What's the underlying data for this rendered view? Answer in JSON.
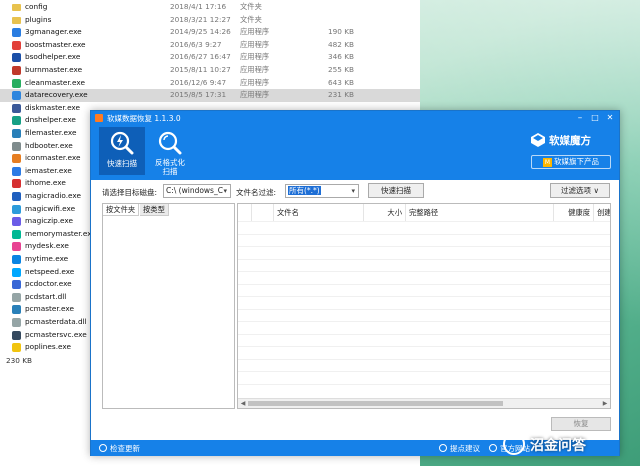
{
  "explorer": {
    "files": [
      {
        "name": "config",
        "date": "2018/4/1 17:16",
        "type": "文件夹",
        "size": "",
        "icon": "folder-icon",
        "color": "#e8c24e"
      },
      {
        "name": "plugins",
        "date": "2018/3/21 12:27",
        "type": "文件夹",
        "size": "",
        "icon": "folder-icon",
        "color": "#e8c24e"
      },
      {
        "name": "3gmanager.exe",
        "date": "2014/9/25 14:26",
        "type": "应用程序",
        "size": "190 KB",
        "icon": "app-icon",
        "color": "#2a7de1"
      },
      {
        "name": "boostmaster.exe",
        "date": "2016/6/3 9:27",
        "type": "应用程序",
        "size": "482 KB",
        "icon": "app-icon",
        "color": "#e2403a"
      },
      {
        "name": "bsodhelper.exe",
        "date": "2016/6/27 16:47",
        "type": "应用程序",
        "size": "346 KB",
        "icon": "app-icon",
        "color": "#1b4fa8"
      },
      {
        "name": "burnmaster.exe",
        "date": "2015/8/11 10:27",
        "type": "应用程序",
        "size": "255 KB",
        "icon": "app-icon",
        "color": "#c0392b"
      },
      {
        "name": "cleanmaster.exe",
        "date": "2016/12/6 9:47",
        "type": "应用程序",
        "size": "643 KB",
        "icon": "app-icon",
        "color": "#27ae60"
      },
      {
        "name": "datarecovery.exe",
        "date": "2015/8/5 17:31",
        "type": "应用程序",
        "size": "231 KB",
        "icon": "app-icon",
        "color": "#2e86de",
        "selected": true
      },
      {
        "name": "diskmaster.exe",
        "date": "",
        "type": "",
        "size": "",
        "icon": "app-icon",
        "color": "#3b5998"
      },
      {
        "name": "dnshelper.exe",
        "date": "",
        "type": "",
        "size": "",
        "icon": "app-icon",
        "color": "#16a085"
      },
      {
        "name": "filemaster.exe",
        "date": "",
        "type": "",
        "size": "",
        "icon": "app-icon",
        "color": "#2980b9"
      },
      {
        "name": "hdbooter.exe",
        "date": "",
        "type": "",
        "size": "",
        "icon": "app-icon",
        "color": "#7f8c8d"
      },
      {
        "name": "iconmaster.exe",
        "date": "",
        "type": "",
        "size": "",
        "icon": "app-icon",
        "color": "#e67e22"
      },
      {
        "name": "iemaster.exe",
        "date": "",
        "type": "",
        "size": "",
        "icon": "app-icon",
        "color": "#2c7be5"
      },
      {
        "name": "ithome.exe",
        "date": "",
        "type": "",
        "size": "",
        "icon": "app-icon",
        "color": "#d63031"
      },
      {
        "name": "magicradio.exe",
        "date": "",
        "type": "",
        "size": "",
        "icon": "app-icon",
        "color": "#1f5fbf"
      },
      {
        "name": "magicwifi.exe",
        "date": "",
        "type": "",
        "size": "",
        "icon": "app-icon",
        "color": "#2d9cdb"
      },
      {
        "name": "magiczip.exe",
        "date": "",
        "type": "",
        "size": "",
        "icon": "app-icon",
        "color": "#6c5ce7"
      },
      {
        "name": "memorymaster.exe",
        "date": "",
        "type": "",
        "size": "",
        "icon": "app-icon",
        "color": "#00b894"
      },
      {
        "name": "mydesk.exe",
        "date": "",
        "type": "",
        "size": "",
        "icon": "app-icon",
        "color": "#e84393"
      },
      {
        "name": "mytime.exe",
        "date": "",
        "type": "",
        "size": "",
        "icon": "app-icon",
        "color": "#0984e3"
      },
      {
        "name": "netspeed.exe",
        "date": "",
        "type": "",
        "size": "",
        "icon": "app-icon",
        "color": "#00a8ff"
      },
      {
        "name": "pcdoctor.exe",
        "date": "",
        "type": "",
        "size": "",
        "icon": "app-icon",
        "color": "#3867d6"
      },
      {
        "name": "pcdstart.dll",
        "date": "",
        "type": "",
        "size": "",
        "icon": "dll-icon",
        "color": "#95a5a6"
      },
      {
        "name": "pcmaster.exe",
        "date": "",
        "type": "",
        "size": "",
        "icon": "app-icon",
        "color": "#2980b9"
      },
      {
        "name": "pcmasterdata.dll",
        "date": "",
        "type": "",
        "size": "",
        "icon": "dll-icon",
        "color": "#95a5a6"
      },
      {
        "name": "pcmastersvc.exe",
        "date": "",
        "type": "",
        "size": "",
        "icon": "app-icon",
        "color": "#34495e"
      },
      {
        "name": "poplines.exe",
        "date": "",
        "type": "",
        "size": "",
        "icon": "app-icon",
        "color": "#f1c40f"
      }
    ],
    "status": "230 KB"
  },
  "app": {
    "title": "软媒数据恢复 1.1.3.0",
    "window_controls": {
      "minimize": "–",
      "maximize": "□",
      "close": "✕"
    },
    "toolbar": {
      "quick_scan": "快速扫描",
      "unformat_line1": "反格式化",
      "unformat_line2": "扫描"
    },
    "brand": {
      "name": "软媒魔方",
      "sub": "软媒旗下产品",
      "sub_mark": "M"
    },
    "filter": {
      "disk_label": "请选择目标磁盘:",
      "disk_value": "C:\\ (windows_C",
      "name_filter_label": "文件名过滤:",
      "name_filter_value": "所有(*.*)",
      "scan_button": "快速扫描",
      "filter_options": "过滤选项"
    },
    "left_tabs": {
      "by_folder": "按文件夹",
      "by_type": "按类型"
    },
    "columns": {
      "name": "文件名",
      "size": "大小",
      "path": "完整路径",
      "health": "健康度",
      "created": "创建"
    },
    "restore_button": "恢复",
    "footer": {
      "check_update": "检查更新",
      "suggest": "提点建议",
      "official_site": "官方网站"
    }
  },
  "watermark": {
    "text": "沼金问答"
  },
  "colors": {
    "accent": "#1681e8",
    "selection": "#d9d9d9"
  }
}
